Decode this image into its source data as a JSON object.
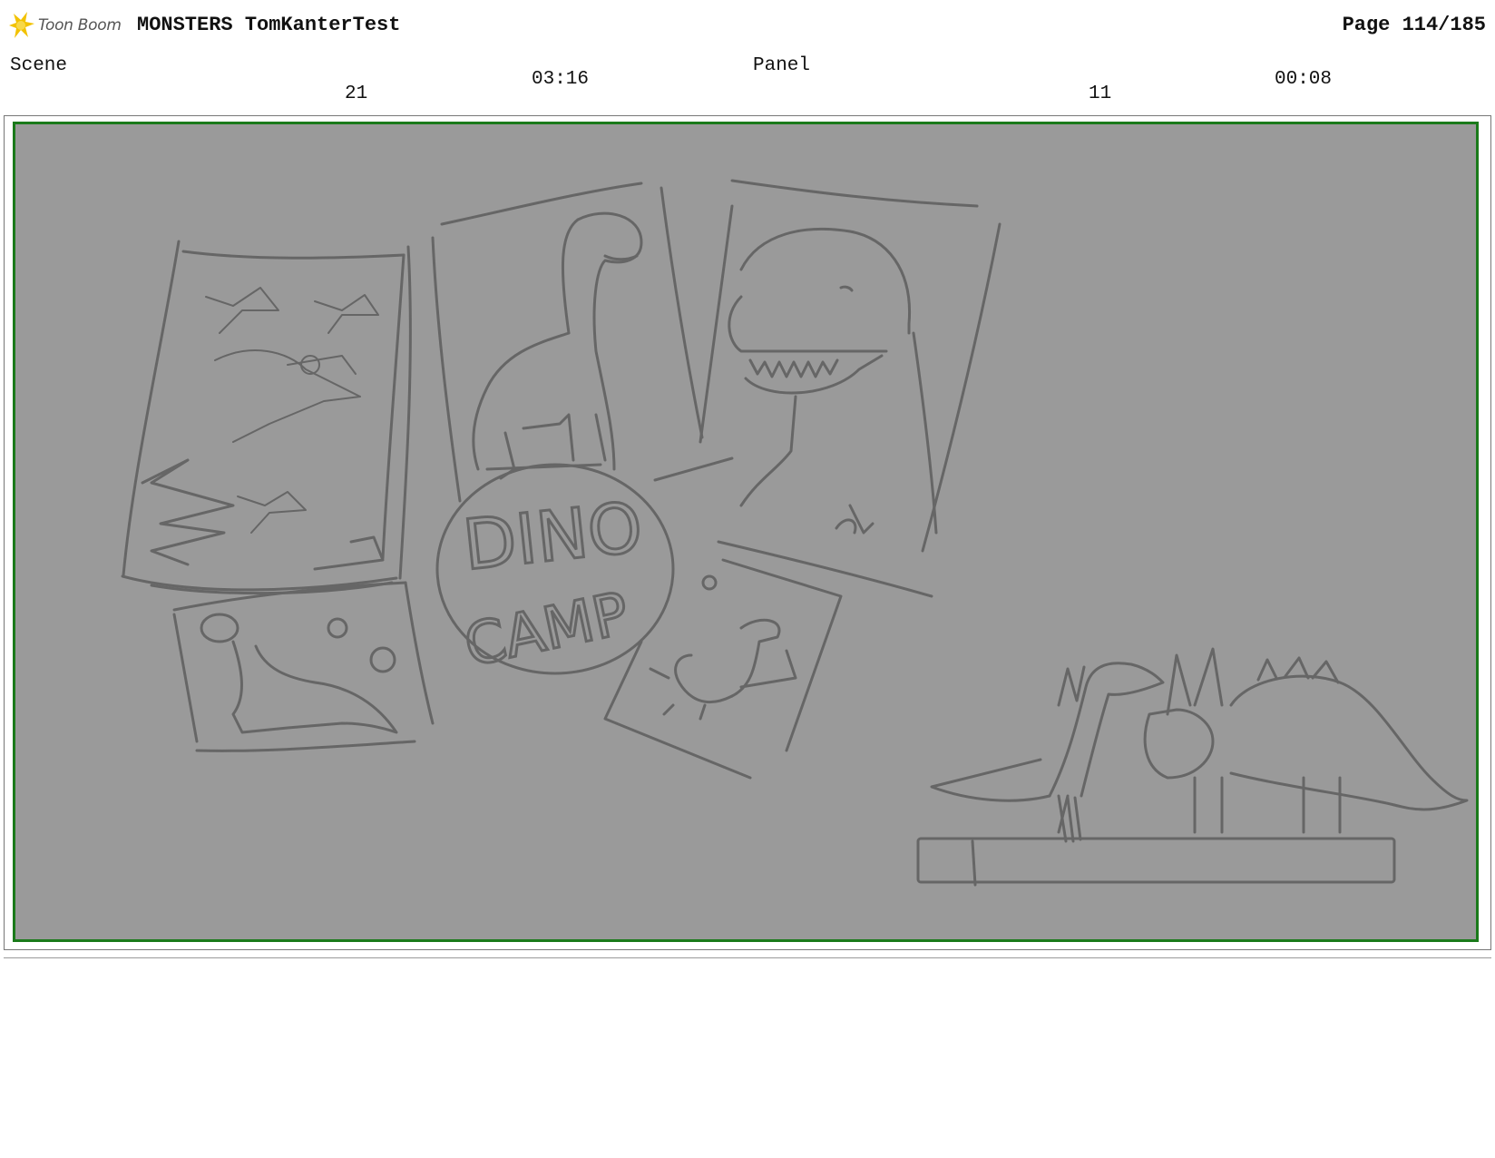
{
  "header": {
    "logo_text": "Toon Boom",
    "title": "MONSTERS TomKanterTest",
    "page": "Page 114/185"
  },
  "info": {
    "scene_label": "Scene",
    "scene_number": "21",
    "scene_duration": "03:16",
    "panel_label": "Panel",
    "panel_number": "11",
    "panel_duration": "00:08"
  },
  "sketch": {
    "sign_line1": "DINO",
    "sign_line2": "CAMP"
  },
  "colors": {
    "frame_border": "#1a7a1a",
    "frame_fill": "#9a9a9a",
    "sketch_stroke": "#666666",
    "logo_star": "#f2c200"
  }
}
